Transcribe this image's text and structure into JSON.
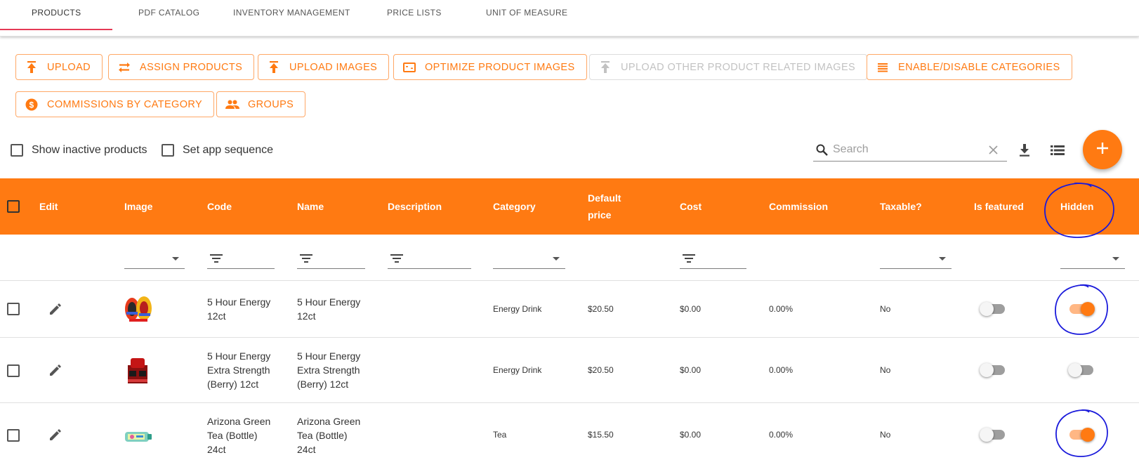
{
  "tabs": [
    {
      "label": "PRODUCTS",
      "active": true
    },
    {
      "label": "PDF CATALOG",
      "active": false
    },
    {
      "label": "INVENTORY MANAGEMENT",
      "active": false
    },
    {
      "label": "PRICE LISTS",
      "active": false
    },
    {
      "label": "UNIT OF MEASURE",
      "active": false
    }
  ],
  "actions": {
    "upload": {
      "label": "UPLOAD",
      "icon": "upload-icon"
    },
    "assign_products": {
      "label": "ASSIGN PRODUCTS",
      "icon": "swap-arrows-icon"
    },
    "upload_images": {
      "label": "UPLOAD IMAGES",
      "icon": "upload-icon"
    },
    "optimize_images": {
      "label": "OPTIMIZE PRODUCT IMAGES",
      "icon": "image-aspect-icon"
    },
    "upload_other": {
      "label": "UPLOAD OTHER PRODUCT RELATED IMAGES",
      "icon": "upload-icon",
      "disabled": true
    },
    "enable_disable_categories": {
      "label": "ENABLE/DISABLE CATEGORIES",
      "icon": "list-lines-icon"
    },
    "commissions": {
      "label": "COMMISSIONS BY CATEGORY",
      "icon": "dollar-circle-icon"
    },
    "groups": {
      "label": "GROUPS",
      "icon": "people-icon"
    }
  },
  "toolbar": {
    "show_inactive_label": "Show inactive products",
    "set_app_sequence_label": "Set app sequence",
    "search_placeholder": "Search"
  },
  "table": {
    "columns": {
      "edit": "Edit",
      "image": "Image",
      "code": "Code",
      "name": "Name",
      "description": "Description",
      "category": "Category",
      "default_price_line1": "Default",
      "default_price_line2": "price",
      "cost": "Cost",
      "commission": "Commission",
      "taxable": "Taxable?",
      "is_featured": "Is featured",
      "hidden": "Hidden"
    },
    "rows": [
      {
        "code": [
          "5 Hour Energy",
          "12ct"
        ],
        "name": [
          "5 Hour Energy",
          "12ct"
        ],
        "description": "",
        "category": "Energy Drink",
        "default_price": "$20.50",
        "cost": "$0.00",
        "commission": "0.00%",
        "taxable": "No",
        "is_featured": false,
        "hidden": true
      },
      {
        "code": [
          "5 Hour Energy",
          "Extra Strength",
          "(Berry) 12ct"
        ],
        "name": [
          "5 Hour Energy",
          "Extra Strength",
          "(Berry) 12ct"
        ],
        "description": "",
        "category": "Energy Drink",
        "default_price": "$20.50",
        "cost": "$0.00",
        "commission": "0.00%",
        "taxable": "No",
        "is_featured": false,
        "hidden": false
      },
      {
        "code": [
          "Arizona Green",
          "Tea (Bottle)",
          "24ct"
        ],
        "name": [
          "Arizona Green",
          "Tea (Bottle)",
          "24ct"
        ],
        "description": "",
        "category": "Tea",
        "default_price": "$15.50",
        "cost": "$0.00",
        "commission": "0.00%",
        "taxable": "No",
        "is_featured": false,
        "hidden": true
      }
    ]
  },
  "colors": {
    "accent": "#ff7a12",
    "tab_indicator": "#e53955",
    "annotation": "#1a1adb"
  }
}
